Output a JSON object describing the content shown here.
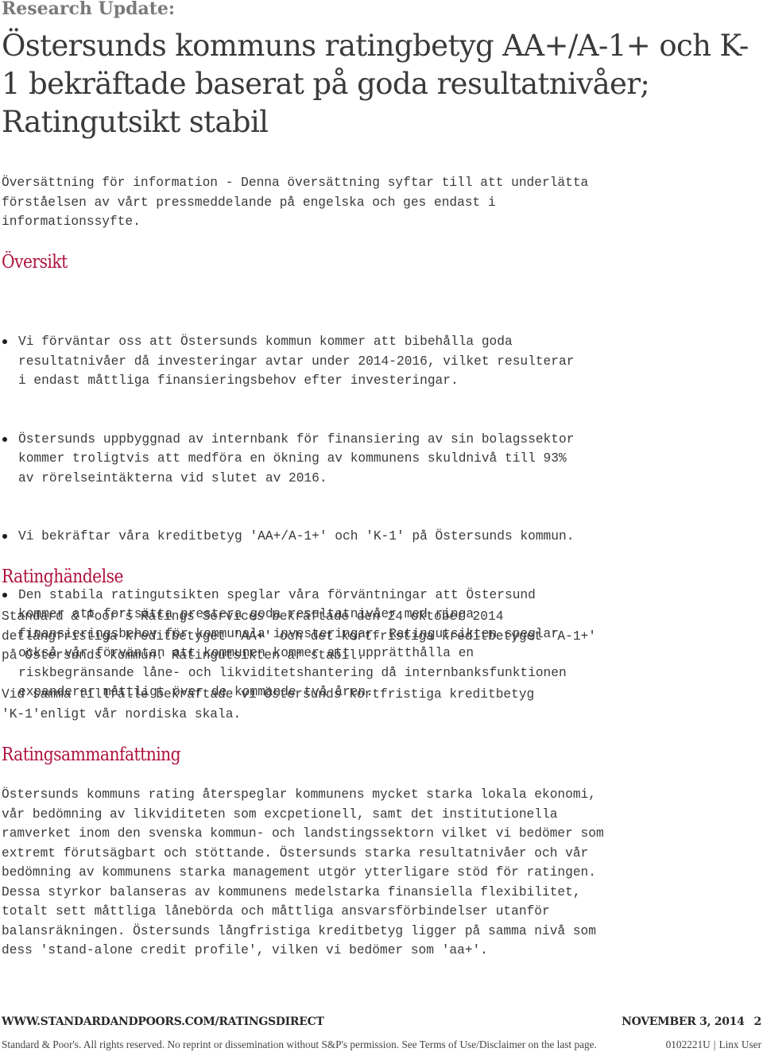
{
  "header": {
    "kicker": "Research Update:",
    "title": "Östersunds kommuns ratingbetyg AA+/A-1+ och K-1 bekräftade baserat på goda resultatnivåer; Ratingutsikt stabil"
  },
  "intro": "Översättning för information - Denna översättning syftar till att underlätta\nförståelsen av vårt pressmeddelande på engelska och ges endast i\ninformationssyfte.",
  "sections": {
    "oversikt": {
      "heading": "Översikt",
      "bullets": [
        "Vi förväntar oss att Östersunds kommun kommer att bibehålla goda\nresultatnivåer då investeringar avtar under 2014-2016, vilket resulterar\ni endast måttliga finansieringsbehov efter investeringar.",
        "Östersunds uppbyggnad av internbank för finansiering av sin bolagssektor\nkommer troligtvis att medföra en ökning av kommunens skuldnivå till 93%\nav rörelseintäkterna vid slutet av 2016.",
        "Vi bekräftar våra kreditbetyg 'AA+/A-1+' och 'K-1' på Östersunds kommun.",
        "Den stabila ratingutsikten speglar våra förväntningar att Östersund\nkommer att fortsätta prestera goda resultatnivåer med ringa\nfinansieringsbehov för kommunala investeringar. Ratingutsikten speglar\nockså vår förväntan att kommunen kommer att upprätthålla en\nriskbegränsande låne- och likviditetshantering då internbanksfunktionen\nexpanderar måttligt över de kommande två åren."
      ]
    },
    "ratinghandelse": {
      "heading": "Ratinghändelse",
      "paragraphs": [
        "Standard & Poor's Ratings Services bekräftade den 24 oktober 2014\ndetlångfristiga kreditbetyget 'AA+' och det kortfristiga kreditbetyget 'A-1+'\npå Östersunds kommun. Ratingutsikten är stabil.",
        "Vid samma tillfälle bekräftade vi Östersunds kortfristiga kreditbetyg\n'K-1'enligt vår nordiska skala."
      ]
    },
    "ratingsammanfattning": {
      "heading": "Ratingsammanfattning",
      "paragraph": "Östersunds kommuns rating återspeglar kommunens mycket starka lokala ekonomi,\nvår bedömning av likviditeten som excpetionell, samt det institutionella\nramverket inom den svenska kommun- och landstingssektorn vilket vi bedömer som\nextremt förutsägbart och stöttande. Östersunds starka resultatnivåer och vår\nbedömning av kommunens starka management utgör ytterligare stöd för ratingen.\nDessa styrkor balanseras av kommunens medelstarka finansiella flexibilitet,\ntotalt sett måttliga lånebörda och måttliga ansvarsförbindelser utanför\nbalansräkningen. Östersunds långfristiga kreditbetyg ligger på samma nivå som\ndess 'stand-alone credit profile', vilken vi bedömer som 'aa+'."
    }
  },
  "footer": {
    "url": "WWW.STANDARDANDPOORS.COM/RATINGSDIRECT",
    "date": "NOVEMBER 3, 2014",
    "page_number": "2",
    "legal": "Standard & Poor's. All rights reserved. No reprint or dissemination without S&P's permission. See Terms of Use/Disclaimer on the last page.",
    "doc_id": "0102221U",
    "separator": "|",
    "user": "Linx User"
  },
  "colors": {
    "heading_accent": "#b0113e",
    "kicker_gray": "#7a7a7a",
    "body_text": "#3a3a3a"
  }
}
